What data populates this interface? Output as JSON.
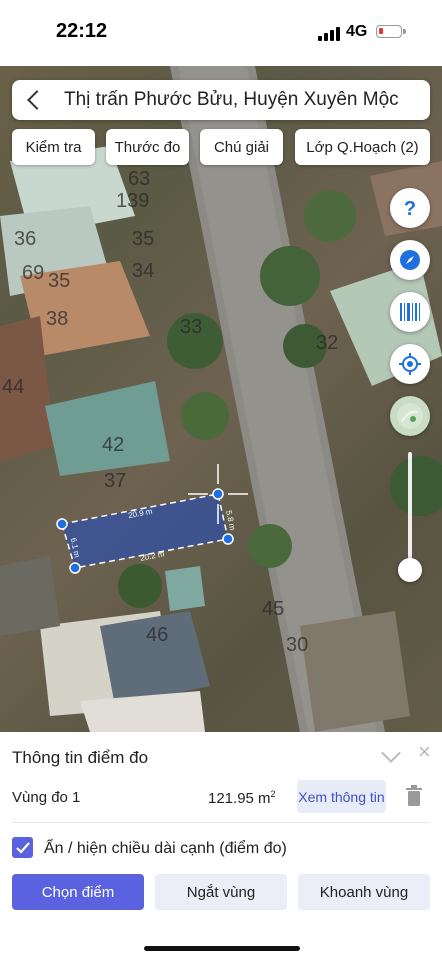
{
  "status_bar": {
    "time": "22:12",
    "network": "4G",
    "battery_color": "#e53935"
  },
  "search": {
    "title": "Thị trấn Phước Bửu, Huyện Xuyên Mộc"
  },
  "chips": [
    {
      "label": "Kiểm tra"
    },
    {
      "label": "Thước đo"
    },
    {
      "label": "Chú giải"
    },
    {
      "label": "Lớp Q.Hoạch (2)"
    }
  ],
  "map": {
    "plot_labels": [
      "63",
      "139",
      "36",
      "35",
      "69",
      "35",
      "34",
      "38",
      "33",
      "32",
      "44",
      "42",
      "37",
      "45",
      "46",
      "30"
    ],
    "measure": {
      "top_edge": "20.9 m",
      "right_edge": "5.8 m",
      "left_edge": "6.1 m",
      "bottom_edge": "20.2 m",
      "polygon_color": "#2f4fa8",
      "vertex_color": "#1e6fe0"
    },
    "tools": [
      "help-icon",
      "compass-icon",
      "barcode-icon",
      "locate-icon",
      "map-thumbnail-icon"
    ],
    "zoom_level": 0.1
  },
  "panel": {
    "title": "Thông tin điểm đo",
    "region_label": "Vùng đo 1",
    "area_value": "121.95 m",
    "area_unit_sup": "2",
    "info_button": "Xem thông tin",
    "checkbox_label": "Ẩn / hiện chiều dài cạnh (điểm đo)",
    "checkbox_checked": true,
    "buttons": {
      "choose_point": "Chọn điểm",
      "split_region": "Ngắt vùng",
      "enclose_region": "Khoanh vùng"
    },
    "accent": "#5a62e0"
  }
}
